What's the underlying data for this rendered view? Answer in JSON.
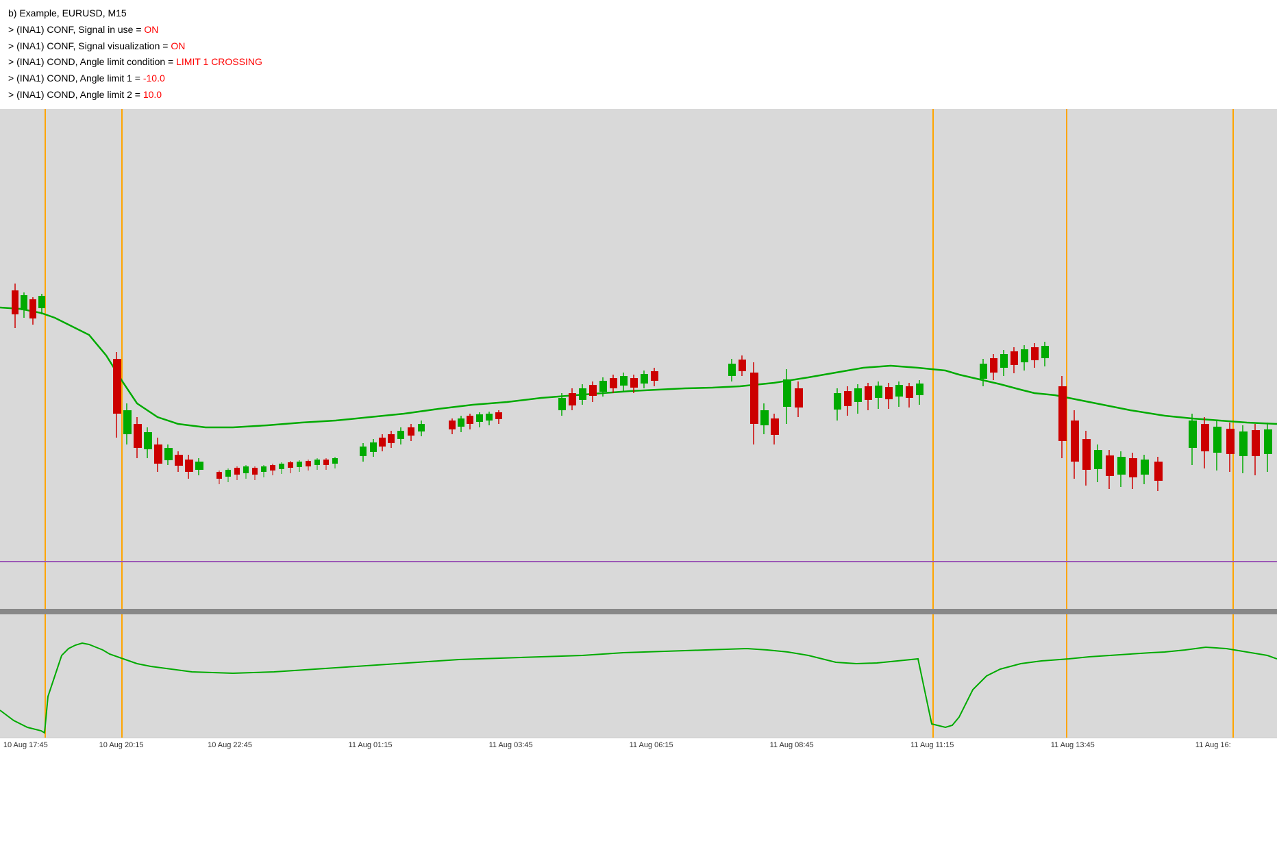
{
  "info": {
    "title": "b) Example, EURUSD, M15",
    "line1_prefix": "> (INA1) CONF, Signal in use = ",
    "line1_value": "ON",
    "line2_prefix": "> (INA1) CONF, Signal visualization = ",
    "line2_value": "ON",
    "line3_prefix": "> (INA1) COND, Angle limit condition = ",
    "line3_value": "LIMIT 1 CROSSING",
    "line4_prefix": "> (INA1) COND, Angle limit 1 = ",
    "line4_value": "-10.0",
    "line5_prefix": "> (INA1) COND, Angle limit 2 = ",
    "line5_value": "10.0"
  },
  "time_labels": [
    {
      "label": "10 Aug 17:45",
      "pct": 2
    },
    {
      "label": "10 Aug 20:15",
      "pct": 9
    },
    {
      "label": "10 Aug 22:45",
      "pct": 18
    },
    {
      "label": "11 Aug 01:15",
      "pct": 29
    },
    {
      "label": "11 Aug 03:45",
      "pct": 40
    },
    {
      "label": "11 Aug 06:15",
      "pct": 51
    },
    {
      "label": "11 Aug 08:45",
      "pct": 62
    },
    {
      "label": "11 Aug 11:15",
      "pct": 73
    },
    {
      "label": "11 Aug 13:45",
      "pct": 84
    },
    {
      "label": "11 Aug 16:",
      "pct": 95
    }
  ],
  "vlines_pct": [
    3.5,
    9.5,
    73,
    83.5,
    96.5
  ],
  "colors": {
    "bull": "#00aa00",
    "bear": "#cc0000",
    "ma": "#00aa00",
    "vline": "#FFA500",
    "purple": "#9b59b6",
    "bg_main": "#d9d9d9",
    "bg_sub": "#d9d9d9"
  }
}
